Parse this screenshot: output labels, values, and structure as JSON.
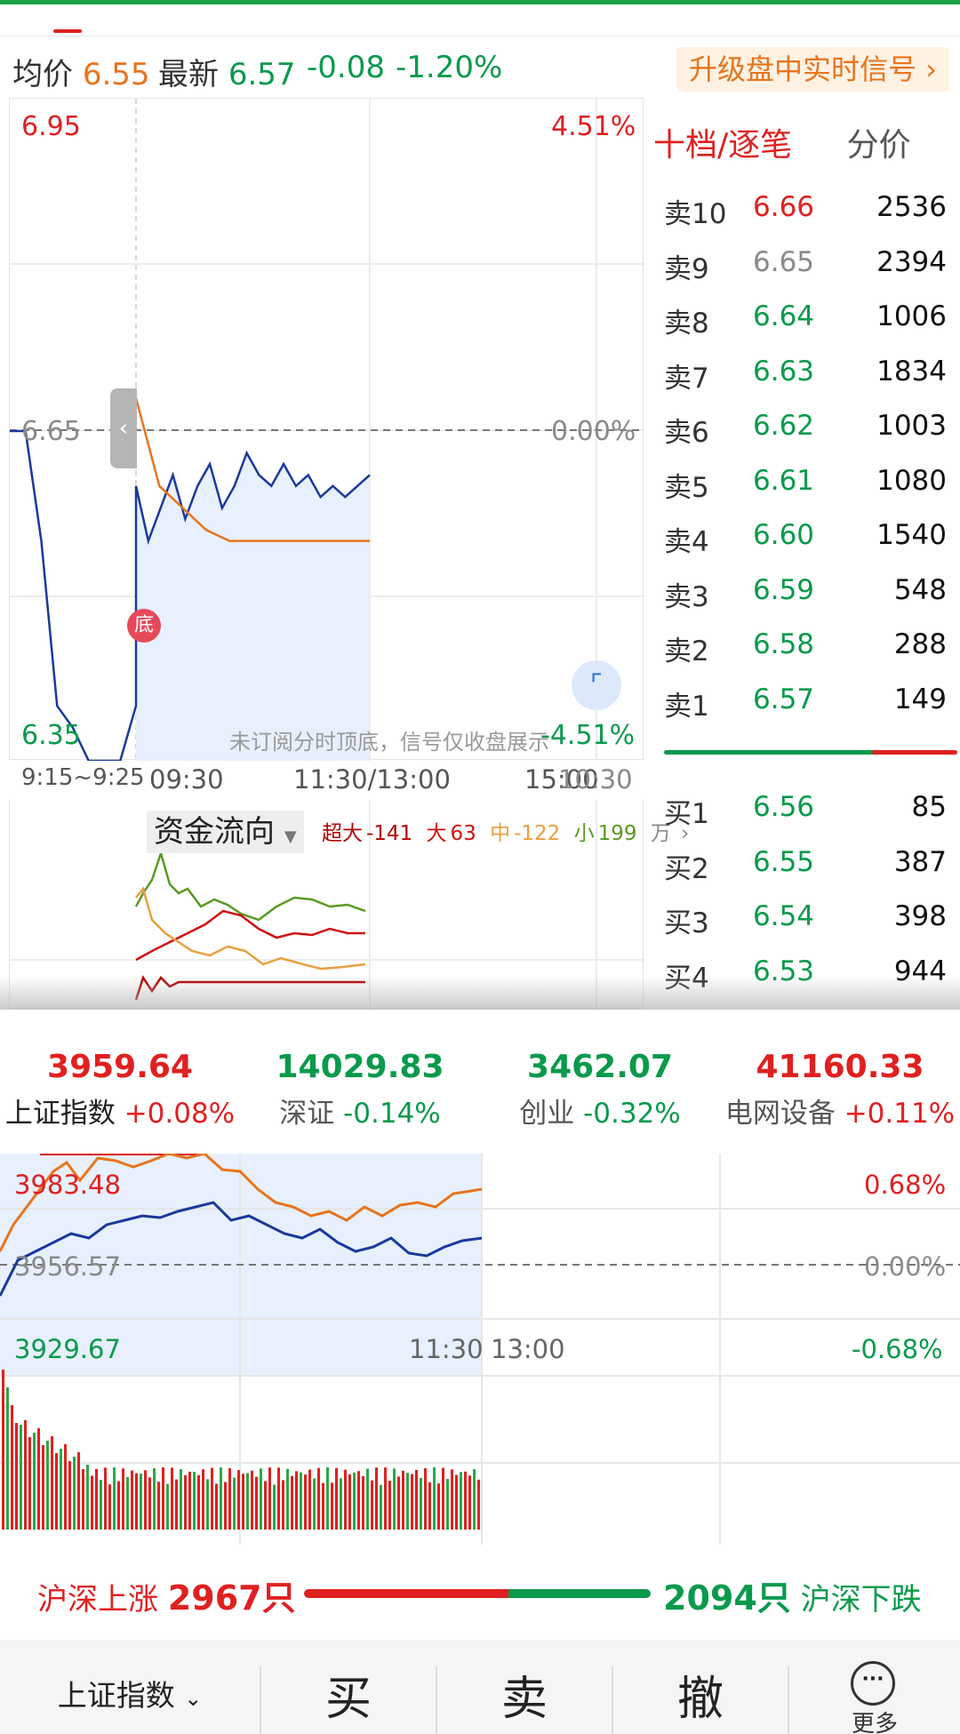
{
  "colors": {
    "up": "#e02020",
    "down": "#0a9a4c",
    "avg": "#e8741c",
    "price_line": "#1a3a9a"
  },
  "quote": {
    "avg_label": "均价",
    "avg_value": "6.55",
    "last_label": "最新",
    "last_value": "6.57",
    "change": "-0.08",
    "change_pct": "-1.20%",
    "upgrade_label": "升级盘中实时信号 ›"
  },
  "intraday": {
    "y_max": "6.95",
    "y_mid": "6.65",
    "y_min": "6.35",
    "pct_max": "4.51%",
    "pct_mid": "0.00%",
    "pct_min": "-4.51%",
    "times": {
      "auction": "9:15~9:25",
      "open": "09:30",
      "noon": "11:30/13:00",
      "close": "15:00",
      "close_overlay": "10:30"
    },
    "notice": "未订阅分时顶底，信号仅收盘展示",
    "bottom_mark": "底",
    "collapse_icon": "chevron-left-icon",
    "expand_icon": "expand-icon",
    "chart_data": {
      "type": "line",
      "title": "",
      "ylim": [
        6.35,
        6.95
      ],
      "series": [
        {
          "name": "最新",
          "values": [
            6.65,
            6.65,
            6.55,
            6.4,
            6.38,
            6.35,
            6.35,
            6.35,
            6.4,
            6.6,
            6.55,
            6.58,
            6.61,
            6.57,
            6.6,
            6.62,
            6.58,
            6.6,
            6.63,
            6.61,
            6.6,
            6.62,
            6.6,
            6.61,
            6.59,
            6.6,
            6.59,
            6.6,
            6.61
          ]
        },
        {
          "name": "均价",
          "values": [
            6.68,
            6.6,
            6.58,
            6.56,
            6.55,
            6.55,
            6.55,
            6.55,
            6.55,
            6.55,
            6.55
          ]
        }
      ]
    }
  },
  "fund_flow": {
    "title": "资金流向",
    "items": [
      {
        "label": "超大",
        "value": "-141"
      },
      {
        "label": "大",
        "value": "63"
      },
      {
        "label": "中",
        "value": "-122"
      },
      {
        "label": "小",
        "value": "199"
      }
    ],
    "unit": "万",
    "arrow": "›"
  },
  "order_book": {
    "tab_active": "十档/逐笔",
    "tab_other": "分价",
    "asks": [
      {
        "level": "卖10",
        "price": "6.66",
        "vol": "2536",
        "dir": "up"
      },
      {
        "level": "卖9",
        "price": "6.65",
        "vol": "2394",
        "dir": "flat"
      },
      {
        "level": "卖8",
        "price": "6.64",
        "vol": "1006",
        "dir": "down"
      },
      {
        "level": "卖7",
        "price": "6.63",
        "vol": "1834",
        "dir": "down"
      },
      {
        "level": "卖6",
        "price": "6.62",
        "vol": "1003",
        "dir": "down"
      },
      {
        "level": "卖5",
        "price": "6.61",
        "vol": "1080",
        "dir": "down"
      },
      {
        "level": "卖4",
        "price": "6.60",
        "vol": "1540",
        "dir": "down"
      },
      {
        "level": "卖3",
        "price": "6.59",
        "vol": "548",
        "dir": "down"
      },
      {
        "level": "卖2",
        "price": "6.58",
        "vol": "288",
        "dir": "down"
      },
      {
        "level": "卖1",
        "price": "6.57",
        "vol": "149",
        "dir": "down"
      }
    ],
    "bids": [
      {
        "level": "买1",
        "price": "6.56",
        "vol": "85",
        "dir": "down"
      },
      {
        "level": "买2",
        "price": "6.55",
        "vol": "387",
        "dir": "down"
      },
      {
        "level": "买3",
        "price": "6.54",
        "vol": "398",
        "dir": "down"
      },
      {
        "level": "买4",
        "price": "6.53",
        "vol": "944",
        "dir": "down"
      }
    ]
  },
  "indices": [
    {
      "value": "3959.64",
      "name": "上证指数",
      "change": "+0.08%",
      "dir": "up"
    },
    {
      "value": "14029.83",
      "name": "深证",
      "change": "-0.14%",
      "dir": "down"
    },
    {
      "value": "3462.07",
      "name": "创业",
      "change": "-0.32%",
      "dir": "down"
    },
    {
      "value": "41160.33",
      "name": "电网设备",
      "change": "+0.11%",
      "dir": "up"
    }
  ],
  "index_chart": {
    "y_max": "3983.48",
    "y_mid": "3956.57",
    "y_min": "3929.67",
    "pct_max": "0.68%",
    "pct_mid": "0.00%",
    "pct_min": "-0.68%",
    "t_noon": "11:30",
    "t_pm": "13:00"
  },
  "breadth": {
    "up_label": "沪深上涨",
    "up_count": "2967只",
    "down_count": "2094只",
    "down_label": "沪深下跌"
  },
  "bottom_nav": {
    "index_select": "上证指数",
    "buy": "买",
    "sell": "卖",
    "cancel": "撤",
    "more": "更多",
    "select_icon": "chevron-down-icon",
    "more_icon": "more-icon"
  }
}
